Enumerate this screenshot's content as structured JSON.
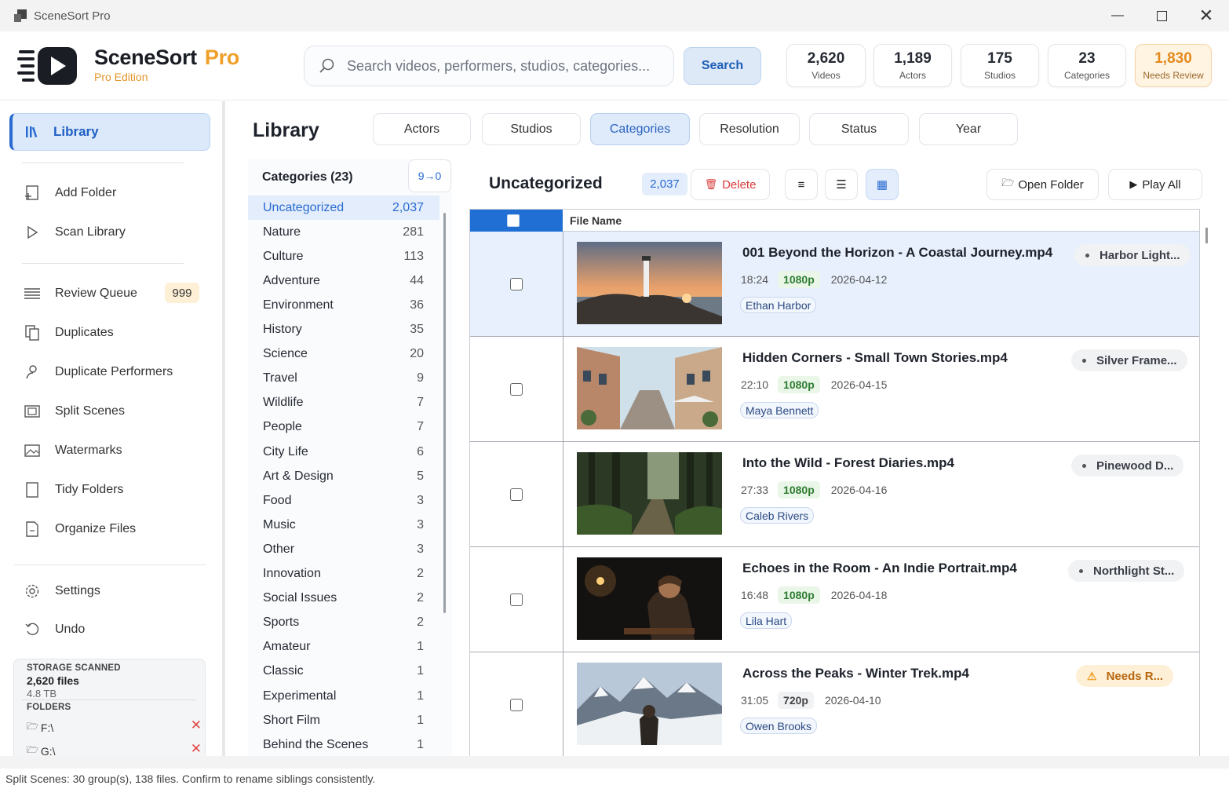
{
  "window": {
    "title": "SceneSort Pro"
  },
  "brand": {
    "name": "SceneSort",
    "pro": "Pro",
    "edition": "Pro Edition"
  },
  "search": {
    "placeholder": "Search videos, performers, studios, categories...",
    "button": "Search"
  },
  "stats": [
    {
      "num": "2,620",
      "label": "Videos"
    },
    {
      "num": "1,189",
      "label": "Actors"
    },
    {
      "num": "175",
      "label": "Studios"
    },
    {
      "num": "23",
      "label": "Categories"
    },
    {
      "num": "1,830",
      "label": "Needs Review"
    }
  ],
  "sidebar": {
    "active": "Library",
    "items": [
      {
        "label": "Add Folder",
        "icon": "add-folder-icon"
      },
      {
        "label": "Scan Library",
        "icon": "play-outline-icon"
      },
      {
        "label": "Review Queue",
        "icon": "list-icon"
      },
      {
        "label": "Duplicates",
        "icon": "copy-icon"
      },
      {
        "label": "Duplicate Performers",
        "icon": "person-icon"
      },
      {
        "label": "Split Scenes",
        "icon": "film-icon"
      },
      {
        "label": "Watermarks",
        "icon": "image-icon"
      },
      {
        "label": "Tidy Folders",
        "icon": "folder-icon"
      },
      {
        "label": "Organize Files",
        "icon": "file-icon"
      },
      {
        "label": "Settings",
        "icon": "gear-icon"
      },
      {
        "label": "Undo",
        "icon": "undo-icon"
      }
    ],
    "review_badge": "999",
    "storage": {
      "heading": "STORAGE SCANNED",
      "files": "2,620 files",
      "size": "4.8 TB",
      "folders_heading": "FOLDERS",
      "folders": [
        "F:\\",
        "G:\\"
      ]
    }
  },
  "library": {
    "title": "Library"
  },
  "tabs": [
    "Actors",
    "Studios",
    "Categories",
    "Resolution",
    "Status",
    "Year"
  ],
  "active_tab": "Categories",
  "categories": {
    "heading": "Categories (23)",
    "sort_label": "9→0",
    "items": [
      {
        "name": "Uncategorized",
        "count": "2,037"
      },
      {
        "name": "Nature",
        "count": "281"
      },
      {
        "name": "Culture",
        "count": "113"
      },
      {
        "name": "Adventure",
        "count": "44"
      },
      {
        "name": "Environment",
        "count": "36"
      },
      {
        "name": "History",
        "count": "35"
      },
      {
        "name": "Science",
        "count": "20"
      },
      {
        "name": "Travel",
        "count": "9"
      },
      {
        "name": "Wildlife",
        "count": "7"
      },
      {
        "name": "People",
        "count": "7"
      },
      {
        "name": "City Life",
        "count": "6"
      },
      {
        "name": "Art & Design",
        "count": "5"
      },
      {
        "name": "Food",
        "count": "3"
      },
      {
        "name": "Music",
        "count": "3"
      },
      {
        "name": "Other",
        "count": "3"
      },
      {
        "name": "Innovation",
        "count": "2"
      },
      {
        "name": "Social Issues",
        "count": "2"
      },
      {
        "name": "Sports",
        "count": "2"
      },
      {
        "name": "Amateur",
        "count": "1"
      },
      {
        "name": "Classic",
        "count": "1"
      },
      {
        "name": "Experimental",
        "count": "1"
      },
      {
        "name": "Short Film",
        "count": "1"
      },
      {
        "name": "Behind the Scenes",
        "count": "1"
      }
    ]
  },
  "group": {
    "title": "Uncategorized",
    "count": "2,037",
    "delete": "Delete",
    "open_folder": "Open Folder",
    "play_all": "Play All",
    "column": "File Name"
  },
  "videos": [
    {
      "title": "001 Beyond the Horizon - A Coastal Journey.mp4",
      "duration": "18:24",
      "res": "1080p",
      "date": "2026-04-12",
      "actor": "Ethan Harbor",
      "studio": "Harbor Light...",
      "warn": false
    },
    {
      "title": "Hidden Corners - Small Town Stories.mp4",
      "duration": "22:10",
      "res": "1080p",
      "date": "2026-04-15",
      "actor": "Maya Bennett",
      "studio": "Silver Frame...",
      "warn": false
    },
    {
      "title": "Into the Wild - Forest Diaries.mp4",
      "duration": "27:33",
      "res": "1080p",
      "date": "2026-04-16",
      "actor": "Caleb Rivers",
      "studio": "Pinewood D...",
      "warn": false
    },
    {
      "title": "Echoes in the Room - An Indie Portrait.mp4",
      "duration": "16:48",
      "res": "1080p",
      "date": "2026-04-18",
      "actor": "Lila Hart",
      "studio": "Northlight St...",
      "warn": false
    },
    {
      "title": "Across the Peaks - Winter Trek.mp4",
      "duration": "31:05",
      "res": "720p",
      "date": "2026-04-10",
      "actor": "Owen Brooks",
      "studio": "Needs R...",
      "warn": true
    }
  ],
  "status": "Split Scenes: 30 group(s), 138 files. Confirm to rename siblings consistently.",
  "colors": {
    "accent": "#2a6bd1",
    "brand_orange": "#f0a02a",
    "danger": "#d83b3b",
    "selected_row": "#e7f0fc"
  }
}
